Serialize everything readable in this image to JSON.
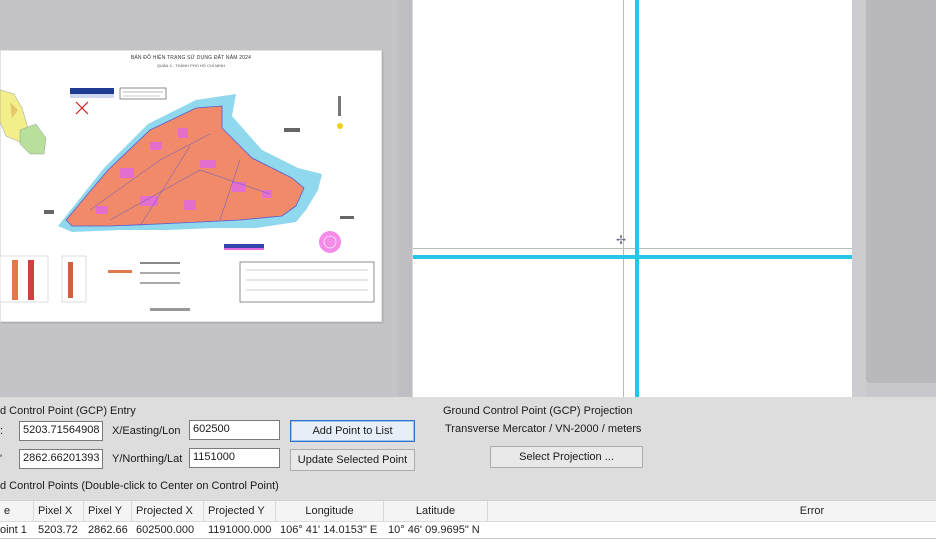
{
  "map": {
    "title": "BẢN ĐỒ HIỆN TRẠNG SỬ DỤNG ĐẤT NĂM 2024",
    "subtitle": "QUẬN 4 - THÀNH PHỐ HỒ CHÍ MINH"
  },
  "gcp_entry": {
    "section_label": "d Control Point (GCP) Entry",
    "x_label": "X/Easting/Lon",
    "y_label": "Y/Northing/Lat",
    "pixel_x_value": "5203.71564908",
    "pixel_y_value": "2862.66201393",
    "easting_value": "602500",
    "northing_value": "1151000",
    "add_button": "Add Point to List",
    "update_button": "Update Selected Point"
  },
  "projection": {
    "section_label": "Ground Control Point (GCP) Projection",
    "value": "Transverse Mercator / VN-2000 / meters",
    "select_button": "Select Projection ..."
  },
  "gcp_list": {
    "section_label": "d Control Points (Double-click to Center on Control Point)",
    "columns": [
      "e",
      "Pixel X",
      "Pixel Y",
      "Projected X",
      "Projected Y",
      "Longitude",
      "Latitude",
      "Error"
    ],
    "rows": [
      [
        "oint 1",
        "5203.72",
        "2862.66",
        "602500.000",
        "1191000.000",
        "106° 41' 14.0153\" E",
        "10° 46' 09.9695\" N",
        ""
      ]
    ]
  },
  "colors": {
    "crosshair": "#27c6e6",
    "map_fill": "#f08a6a",
    "water": "#7fd3ea"
  }
}
